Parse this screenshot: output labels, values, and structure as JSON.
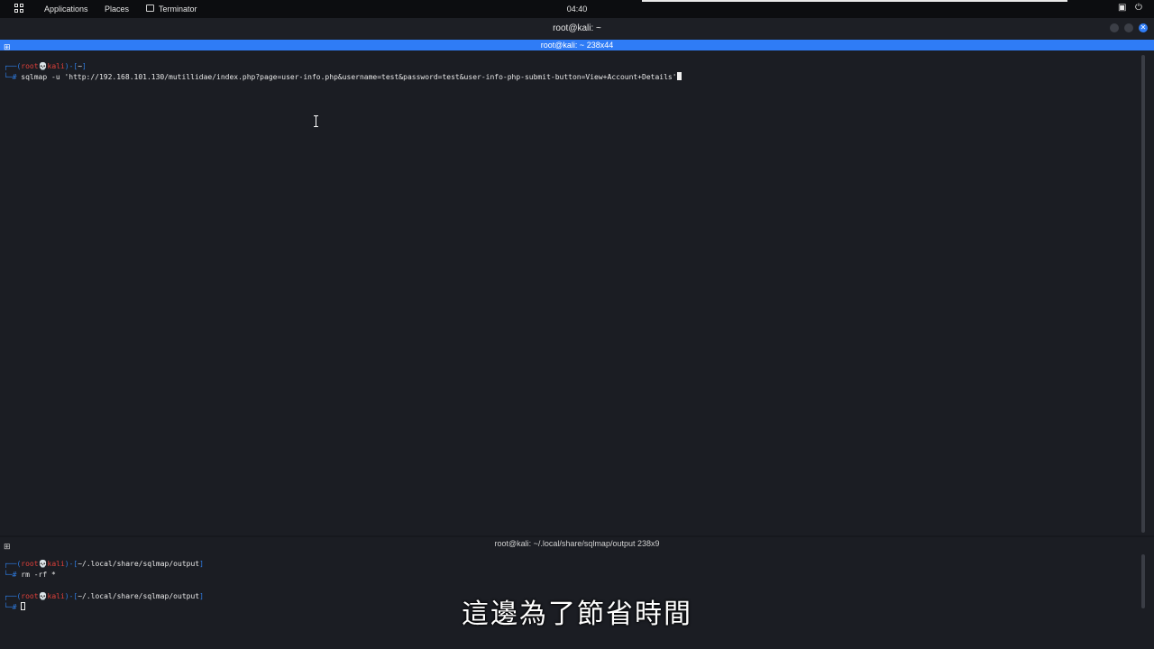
{
  "topbar": {
    "apps_label": "Applications",
    "places_label": "Places",
    "terminator_label": "Terminator",
    "clock": "04:40"
  },
  "window": {
    "title": "root@kali: ~"
  },
  "terminal_top": {
    "title": "root@kali: ~ 238x44",
    "prompt": {
      "open": "┌──(",
      "user": "root",
      "skull": "💀",
      "host": "kali",
      "mid": ")-[",
      "path": "~",
      "close": "]",
      "hash": "└─#"
    },
    "command": "sqlmap -u 'http://192.168.101.130/mutillidae/index.php?page=user-info.php&username=test&password=test&user-info-php-submit-button=View+Account+Details'"
  },
  "terminal_bottom": {
    "title": "root@kali: ~/.local/share/sqlmap/output 238x9",
    "prompt1_path": "~/.local/share/sqlmap/output",
    "prompt1_cmd": "rm -rf *",
    "prompt2_path": "~/.local/share/sqlmap/output"
  },
  "subtitle": "這邊為了節省時間",
  "colors": {
    "accent": "#2f7cf6",
    "prompt_frame": "#2e7be0",
    "prompt_user": "#e0403a",
    "background": "#1b1d23"
  },
  "icons": [
    "grid-icon",
    "terminal-icon",
    "screen-icon",
    "power-icon",
    "split-icon",
    "ibeam-cursor-icon"
  ]
}
